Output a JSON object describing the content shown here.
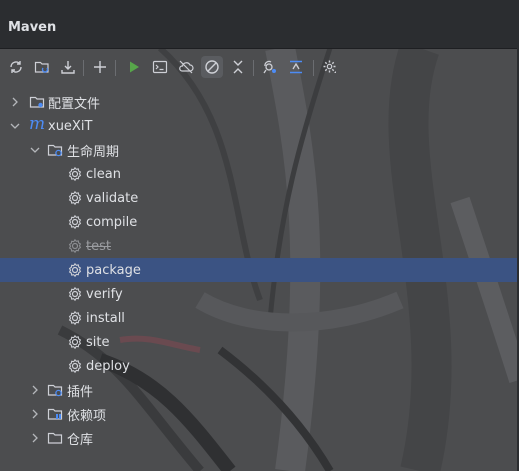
{
  "window": {
    "title": "Maven"
  },
  "toolbar": {
    "buttons": [
      {
        "icon": "reload-icon"
      },
      {
        "icon": "generate-sources-icon"
      },
      {
        "icon": "download-icon"
      },
      {
        "icon": "add-icon"
      },
      {
        "icon": "run-icon"
      },
      {
        "icon": "execute-goal-icon"
      },
      {
        "icon": "offline-mode-icon"
      },
      {
        "icon": "skip-tests-icon",
        "active": true
      },
      {
        "icon": "collapse-all-icon"
      },
      {
        "icon": "show-dependencies-icon"
      },
      {
        "icon": "analyze-dependencies-icon"
      },
      {
        "icon": "settings-icon"
      }
    ]
  },
  "tree": {
    "profiles": {
      "label": "配置文件"
    },
    "project": {
      "label": "xueXiT",
      "logo": "m"
    },
    "lifecycle": {
      "label": "生命周期",
      "goals": [
        {
          "label": "clean"
        },
        {
          "label": "validate"
        },
        {
          "label": "compile"
        },
        {
          "label": "test",
          "skipped": true
        },
        {
          "label": "package",
          "selected": true
        },
        {
          "label": "verify"
        },
        {
          "label": "install"
        },
        {
          "label": "site"
        },
        {
          "label": "deploy"
        }
      ]
    },
    "plugins": {
      "label": "插件"
    },
    "dependencies": {
      "label": "依赖项"
    },
    "repositories": {
      "label": "仓库"
    }
  },
  "colors": {
    "accent": "#4d8cf5",
    "selection": "#3b5383",
    "run": "#57a64a",
    "panel_bg": "#2b2d30"
  }
}
